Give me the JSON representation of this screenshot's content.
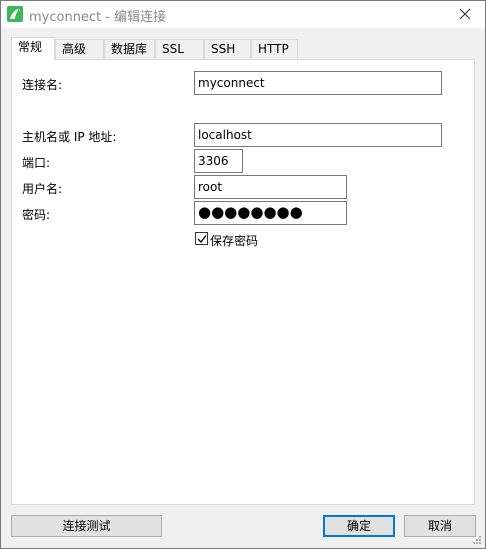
{
  "window": {
    "title": "myconnect - 编辑连接"
  },
  "tabs": [
    {
      "label": "常规",
      "active": true
    },
    {
      "label": "高级",
      "active": false
    },
    {
      "label": "数据库",
      "active": false
    },
    {
      "label": "SSL",
      "active": false
    },
    {
      "label": "SSH",
      "active": false
    },
    {
      "label": "HTTP",
      "active": false
    }
  ],
  "form": {
    "connection_name_label": "连接名:",
    "connection_name_value": "myconnect",
    "host_label": "主机名或 IP 地址:",
    "host_value": "localhost",
    "port_label": "端口:",
    "port_value": "3306",
    "user_label": "用户名:",
    "user_value": "root",
    "password_label": "密码:",
    "password_value": "●●●●●●●●",
    "save_password_label": "保存密码",
    "save_password_checked": true
  },
  "buttons": {
    "test": "连接测试",
    "ok": "确定",
    "cancel": "取消"
  },
  "colors": {
    "accent": "#0078d7",
    "app_icon": "#40b65a"
  }
}
